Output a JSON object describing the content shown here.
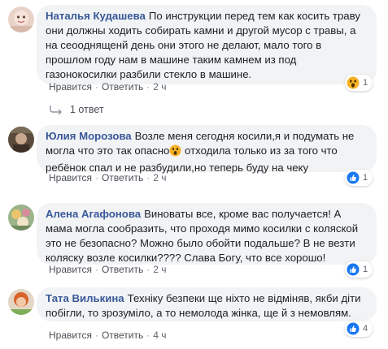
{
  "comments": [
    {
      "name": "Наталья Кудашева",
      "text": "По инструкции перед тем как косить траву они должны ходить собирать камни и другой мусор с травы, а на сеооднященй день они этого не делают, мало того в прошлом году нам в машине таким камнем из под газонокосилки разбили стекло в машине.",
      "like": "Нравится",
      "reply": "Ответить",
      "time": "2 ч",
      "reaction_count": "1",
      "reaction_icon": "wow-icon"
    },
    {
      "name": "Юлия Морозова",
      "text_before": "Возле меня сегодня косили,я и подумать не могла что это так опасно",
      "text_after": " отходила только из за того что ребёнок спал и не разбудили,но теперь буду на чеку",
      "like": "Нравится",
      "reply": "Ответить",
      "time": "2 ч",
      "reaction_count": "1",
      "reaction_icon": "like-icon"
    },
    {
      "name": "Алена Агафонова",
      "text": "Виноваты все, кроме вас получается! А мама могла сообразить, что проходя мимо косилки с коляской это не безопасно? Можно было обойти подальше? В не везти коляску возле косилки???? Слава Богу, что все хорошо!",
      "like": "Нравится",
      "reply": "Ответить",
      "time": "2 ч",
      "reaction_count": "1",
      "reaction_icon": "like-icon"
    },
    {
      "name": "Тата Вилькина",
      "text": "Техніку безпеки ще ніхто не відміняв, якби діти побігли, то зрозуміло, а то немолода жінка, ще й з немовлям.",
      "like": "Нравится",
      "reply": "Ответить",
      "time": "4 ч",
      "reaction_count": "4",
      "reaction_icon": "like-icon"
    }
  ],
  "replies_link": "1 ответ",
  "colors": {
    "link": "#385898",
    "bubble": "#f2f3f5",
    "like_blue": "#1877f2",
    "wow_yellow": "#f7b125"
  }
}
